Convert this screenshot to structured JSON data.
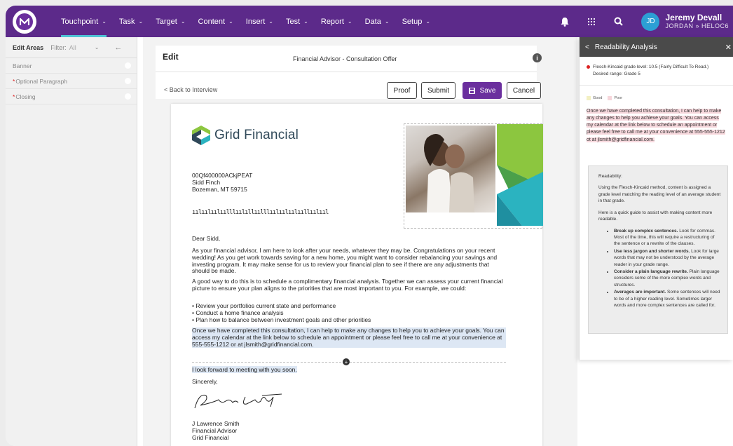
{
  "nav": {
    "items": [
      {
        "label": "Touchpoint",
        "active": true
      },
      {
        "label": "Task"
      },
      {
        "label": "Target"
      },
      {
        "label": "Content"
      },
      {
        "label": "Insert"
      },
      {
        "label": "Test"
      },
      {
        "label": "Report"
      },
      {
        "label": "Data"
      },
      {
        "label": "Setup"
      }
    ],
    "user": {
      "initials": "JD",
      "name": "Jeremy Devall",
      "context": "JORDAN » HELOC6"
    },
    "icons": [
      "bell-icon",
      "apps-grid-icon",
      "search-icon"
    ],
    "brand_color": "#5c2a8a"
  },
  "left_panel": {
    "title": "Edit Areas",
    "filter_label": "Filter:",
    "filter_value": "All",
    "rows": [
      {
        "label": "Banner",
        "required": false
      },
      {
        "label": "Optional Paragraph",
        "required": true
      },
      {
        "label": "Closing",
        "required": true
      }
    ]
  },
  "editor": {
    "title": "Edit",
    "document_name": "Financial Advisor - Consultation Offer",
    "back_label": "< Back to Interview",
    "buttons": {
      "proof": "Proof",
      "submit": "Submit",
      "save": "Save",
      "cancel": "Cancel"
    }
  },
  "letter": {
    "brand": "Grid Financial",
    "address": [
      "00Qf400000ACkjPEAT",
      "Sidd Finch",
      "Bozeman, MT 59715"
    ],
    "barcode": "ıılıılıılıılllıılıllıılllıılıılıılııllıılııl",
    "greeting": "Dear Sidd,",
    "paragraph1": "As your financial advisor, I am here to look after your needs, whatever they may be. Congratulations on your recent wedding! As you get work towards saving for a new home, you might want to consider rebalancing your savings and investing program. It may make sense for us to review your financial plan to see if there are any adjustments that should be made.",
    "paragraph2": "A good way to do this is to schedule a complimentary financial analysis. Together we can assess your current financial picture to ensure your plan aligns to the priorities that are most important to you. For example, we could:",
    "list": [
      "Review your portfolios current state and performance",
      "Conduct a home finance analysis",
      "Plan how to balance between investment goals and other priorities"
    ],
    "paragraph3": "Once we have completed this consultation, I can help to make any changes to help you to achieve your goals. You can access my calendar at the link below to schedule an appointment or please feel free to call me at your convenience at 555-555-1212 or at jlsmith@gridfinancial.com.",
    "closing_line": "I look forward to meeting with you soon.",
    "signoff": "Sincerely,",
    "signature_name": "J Lawrence Smith",
    "signature_title": "Financial Advisor",
    "signature_company": "Grid Financial"
  },
  "readability": {
    "title": "Readability Analysis",
    "grade_line": "Flesch-Kincaid grade level: 10.5 (Fairly Difficult To Read.)",
    "desired_line": "Desired range: Grade 5",
    "legend_good": "Good",
    "legend_poor": "Poor",
    "flagged_text": "Once we have completed this consultation, I can help to make any changes to help you achieve your goals. You can access my calendar at the link below to schedule an appointment or please feel free to call me at your convenience at 555-555-1212 ot at jlsmith@gridfinancial.com.",
    "info_heading": "Readability:",
    "info_p1": "Using the Flesch-Kincaid method, content is assigned a grade level matching the reading level of an average student in that grade.",
    "info_p2": "Here is a quick guide to assist with making content more readable.",
    "tips": [
      {
        "bold": "Break up complex sentences.",
        "text": " Look for commas. Most of the time, this will require a restructuring of the sentence or a rewrite of the clauses."
      },
      {
        "bold": "Use less jargon and shorter words.",
        "text": " Look for large words that may not be understood by the average reader in your grade range."
      },
      {
        "bold": "Consider a plain language rewrite.",
        "text": " Plain language considers some of the more complex words and structures."
      },
      {
        "bold": "Averages are important.",
        "text": " Some sentences will need to be of a higher reading level. Sometimes larger words and more complex sentences are called for."
      }
    ]
  }
}
